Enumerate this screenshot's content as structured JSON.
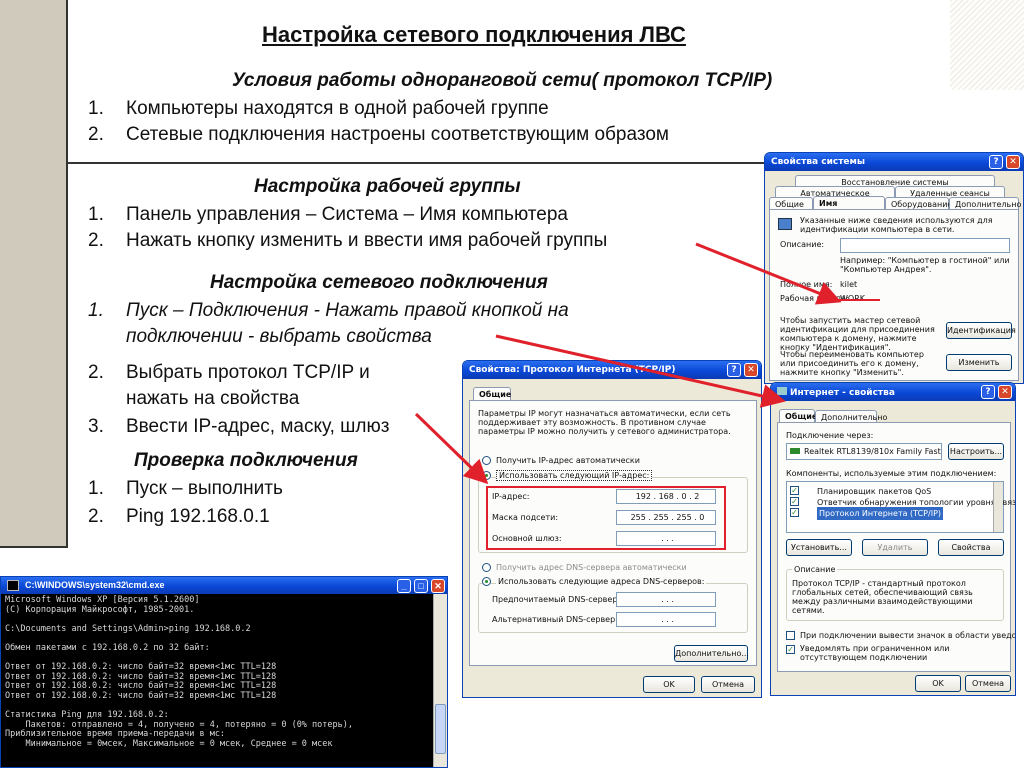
{
  "slide": {
    "title": "Настройка сетевого подключения ЛВС",
    "section1": {
      "heading": "Условия работы одноранговой сети( протокол TCP/IP)",
      "items": [
        {
          "num": "1.",
          "text": "Компьютеры находятся в одной рабочей группе"
        },
        {
          "num": "2.",
          "text": "Сетевые подключения настроены соответствующим образом"
        }
      ]
    },
    "section2": {
      "heading": "Настройка рабочей группы",
      "items": [
        {
          "num": "1.",
          "text": "Панель управления – Система – Имя компьютера"
        },
        {
          "num": "2.",
          "text": "Нажать кнопку изменить и ввести имя рабочей группы"
        }
      ]
    },
    "section3": {
      "heading": "Настройка сетевого подключения",
      "item1": {
        "num": "1.",
        "line1": "Пуск – Подключения - Нажать правой кнопкой на",
        "line2": "подключении - выбрать свойства"
      },
      "item2": {
        "num": "2.",
        "line1": "Выбрать протокол TCP/IP и",
        "line2": "нажать на свойства"
      },
      "item3": {
        "num": "3.",
        "text": "Ввести IP-адрес, маску, шлюз"
      }
    },
    "section4": {
      "heading": "Проверка подключения",
      "items": [
        {
          "num": "1.",
          "text": "Пуск – выполнить"
        },
        {
          "num": "2.",
          "text": "Ping 192.168.0.1"
        }
      ]
    }
  },
  "sysprops": {
    "title": "Свойства системы",
    "tabs_row1": [
      "Восстановление системы"
    ],
    "tabs_row2": [
      "Автоматическое обновление",
      "Удаленные сеансы"
    ],
    "tabs_row3": [
      "Общие",
      "Имя компьютера",
      "Оборудование",
      "Дополнительно"
    ],
    "desc": "Указанные ниже сведения используются для идентификации компьютера в сети.",
    "description_label": "Описание:",
    "example": "Например: \"Компьютер в гостиной\" или \"Компьютер Андрея\".",
    "fullname_label": "Полное имя:",
    "fullname_value": "kilet",
    "workgroup_label": "Рабочая группа:",
    "workgroup_value": "WORK",
    "wizard_text": "Чтобы запустить мастер сетевой идентификации для присоединения компьютера к домену, нажмите кнопку \"Идентификация\".",
    "ident_button": "Идентификация",
    "rename_text": "Чтобы переименовать компьютер или присоединить его к домену, нажмите кнопку \"Изменить\".",
    "change_button": "Изменить"
  },
  "tcpip": {
    "title": "Свойства: Протокол Интернета (TCP/IP)",
    "tab": "Общие",
    "intro": "Параметры IP могут назначаться автоматически, если сеть поддерживает эту возможность. В противном случае параметры IP можно получить у сетевого администратора.",
    "auto_ip": "Получить IP-адрес автоматически",
    "manual_ip": "Использовать следующий IP-адрес:",
    "ip_label": "IP-адрес:",
    "ip_value": "192 . 168 .  0  .  2",
    "mask_label": "Маска подсети:",
    "mask_value": "255 . 255 . 255 .  0",
    "gateway_label": "Основной шлюз:",
    "gateway_value": ".    .    .",
    "auto_dns": "Получить адрес DNS-сервера автоматически",
    "manual_dns": "Использовать следующие адреса DNS-серверов:",
    "pref_dns": "Предпочитаемый DNS-сервер:",
    "alt_dns": "Альтернативный DNS-сервер:",
    "dns_blank": ".    .    .",
    "advanced_button": "Дополнительно...",
    "ok_button": "OK",
    "cancel_button": "Отмена"
  },
  "netprops": {
    "title": "Интернет - свойства",
    "tabs": [
      "Общие",
      "Дополнительно"
    ],
    "connect_via": "Подключение через:",
    "adapter": "Realtek RTL8139/810x Family Fast",
    "configure_button": "Настроить...",
    "components_label": "Компоненты, используемые этим подключением:",
    "components": [
      "Планировщик пакетов QoS",
      "Ответчик обнаружения топологии уровня связи",
      "Протокол Интернета (TCP/IP)"
    ],
    "install_button": "Установить...",
    "remove_button": "Удалить",
    "props_button": "Свойства",
    "desc_label": "Описание",
    "desc_text": "Протокол TCP/IP - стандартный протокол глобальных сетей, обеспечивающий связь между различными взаимодействующими сетями.",
    "notify_icon": "При подключении вывести значок в области уведомлений",
    "notify_limited": "Уведомлять при ограниченном или отсутствующем подключении",
    "ok_button": "OK",
    "cancel_button": "Отмена"
  },
  "cmd": {
    "title": "C:\\WINDOWS\\system32\\cmd.exe",
    "output": "Microsoft Windows XP [Версия 5.1.2600]\n(С) Корпорация Майкрософт, 1985-2001.\n\nC:\\Documents and Settings\\Admin>ping 192.168.0.2\n\nОбмен пакетами с 192.168.0.2 по 32 байт:\n\nОтвет от 192.168.0.2: число байт=32 время<1мс TTL=128\nОтвет от 192.168.0.2: число байт=32 время<1мс TTL=128\nОтвет от 192.168.0.2: число байт=32 время<1мс TTL=128\nОтвет от 192.168.0.2: число байт=32 время<1мс TTL=128\n\nСтатистика Ping для 192.168.0.2:\n    Пакетов: отправлено = 4, получено = 4, потеряно = 0 (0% потерь),\nПриблизительное время приема-передачи в мс:\n    Минимальное = 0мсек, Максимальное = 0 мсек, Среднее = 0 мсек"
  },
  "colors": {
    "accent_red": "#e0202a",
    "xp_title": "#0a48d6",
    "slide_bar": "#cfcabb"
  }
}
